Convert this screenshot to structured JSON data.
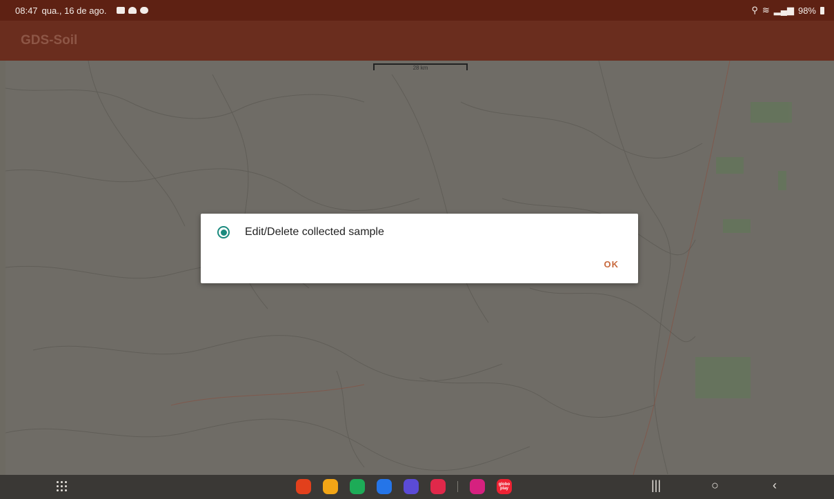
{
  "status_bar": {
    "time": "08:47",
    "date": "qua., 16 de ago.",
    "battery": "98%"
  },
  "app_bar": {
    "title": "GDS-Soil"
  },
  "map": {
    "scale_label": "28 km"
  },
  "dialog": {
    "option_label": "Edit/Delete collected sample",
    "option_selected": true,
    "ok_label": "OK"
  },
  "dock": {
    "apps": [
      {
        "name": "samsung-notes-icon",
        "color": "#e2401c"
      },
      {
        "name": "my-files-icon",
        "color": "#f2a516"
      },
      {
        "name": "phone-icon",
        "color": "#1dab57"
      },
      {
        "name": "messages-icon",
        "color": "#2575e8"
      },
      {
        "name": "internet-icon",
        "color": "#5b4bd6"
      },
      {
        "name": "camera-icon",
        "color": "#e0284a"
      },
      {
        "name": "flower-app-icon",
        "color": "#d6217f"
      },
      {
        "name": "globoplay-icon",
        "color": "#ee2233",
        "label": "globo play"
      }
    ]
  },
  "colors": {
    "status_bar": "#5e2113",
    "app_bar": "#6a2d1e",
    "accent_radio": "#1a8a7e",
    "ok_text": "#c8693d"
  }
}
